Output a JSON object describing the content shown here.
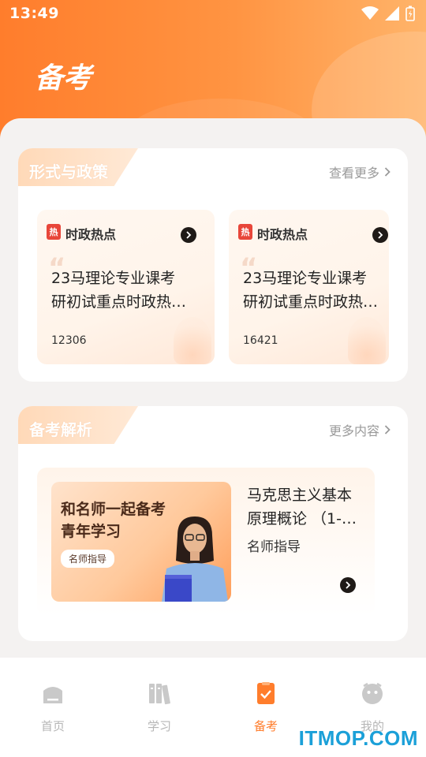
{
  "status_bar": {
    "time": "13:49"
  },
  "header": {
    "title": "备考"
  },
  "sections": {
    "policy": {
      "title": "形式与政策",
      "more_label": "查看更多",
      "items": [
        {
          "badge": "热",
          "tag": "时政热点",
          "title_line1": "23马理论专业课考",
          "title_line2": "研初试重点时政热…",
          "count": "12306"
        },
        {
          "badge": "热",
          "tag": "时政热点",
          "title_line1": "23马理论专业课考",
          "title_line2": "研初试重点时政热…",
          "count": "16421"
        }
      ]
    },
    "analysis": {
      "title": "备考解析",
      "more_label": "更多内容",
      "lesson": {
        "cover_line1": "和名师一起备考",
        "cover_line2": "青年学习",
        "cover_pill": "名师指导",
        "title_line1": "马克思主义基本",
        "title_line2": "原理概论 （1-7…",
        "subtitle": "名师指导"
      }
    }
  },
  "tabbar": {
    "items": [
      {
        "label": "首页",
        "icon": "home-icon",
        "active": false
      },
      {
        "label": "学习",
        "icon": "books-icon",
        "active": false
      },
      {
        "label": "备考",
        "icon": "clipboard-check-icon",
        "active": true
      },
      {
        "label": "我的",
        "icon": "profile-icon",
        "active": false
      }
    ]
  },
  "watermark": "ITMOP.COM",
  "colors": {
    "accent": "#ff7d2c",
    "hot_badge": "#e8463a",
    "inactive": "#b6b6b6"
  }
}
